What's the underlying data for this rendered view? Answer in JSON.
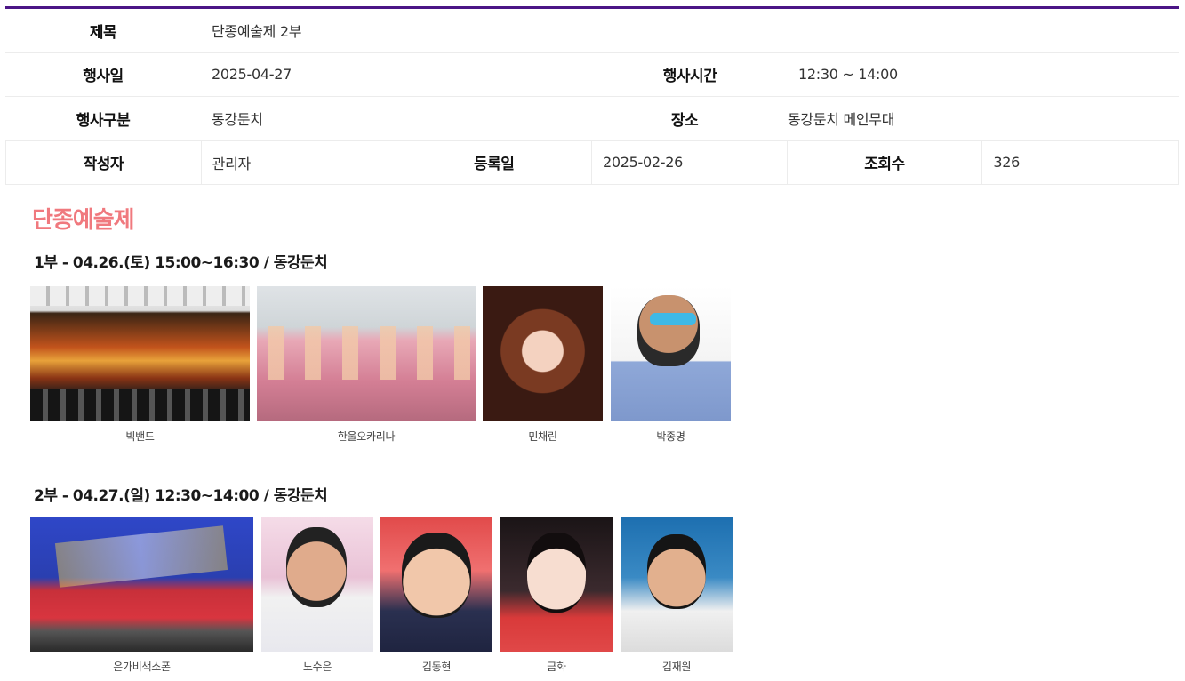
{
  "info": {
    "title_label": "제목",
    "title_value": "단종예술제 2부",
    "date_label": "행사일",
    "date_value": "2025-04-27",
    "time_label": "행사시간",
    "time_value": "12:30 ~ 14:00",
    "category_label": "행사구분",
    "category_value": "동강둔치",
    "place_label": "장소",
    "place_value": "동강둔치 메인무대",
    "author_label": "작성자",
    "author_value": "관리자",
    "registered_label": "등록일",
    "registered_value": "2025-02-26",
    "views_label": "조회수",
    "views_value": "326"
  },
  "content": {
    "section_title": "단종예술제",
    "part1": {
      "title": "1부 - 04.26.(토) 15:00~16:30 / 동강둔치",
      "performers": [
        "빅밴드",
        "한울오카리나",
        "민채린",
        "박종명"
      ]
    },
    "part2": {
      "title": "2부 - 04.27.(일) 12:30~14:00 / 동강둔치",
      "performers": [
        "은가비색소폰",
        "노수은",
        "김동현",
        "금화",
        "김재원"
      ]
    }
  },
  "colors": {
    "top_border": "#4b1586",
    "section_title": "#f0797e"
  }
}
